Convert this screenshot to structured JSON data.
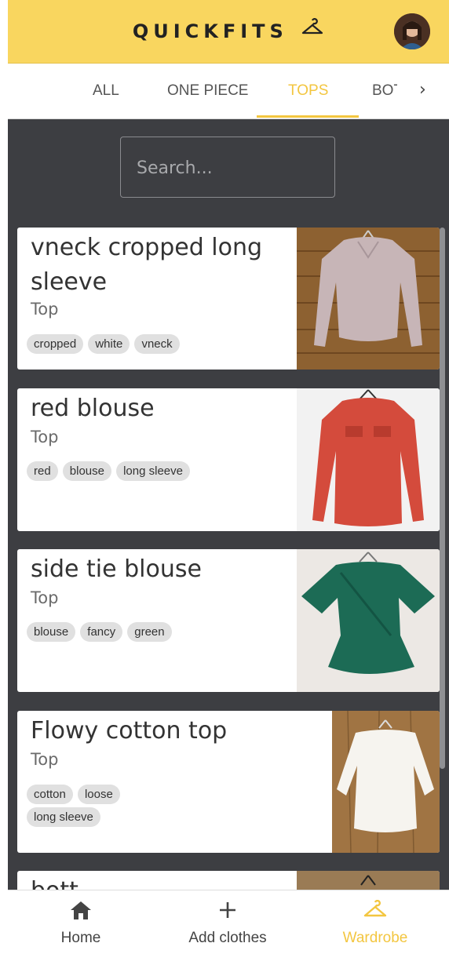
{
  "header": {
    "brand": "QUICKFITS"
  },
  "tabs": {
    "items": [
      {
        "label": "ALL"
      },
      {
        "label": "ONE PIECE"
      },
      {
        "label": "TOPS"
      },
      {
        "label": "BOT"
      }
    ],
    "active": "TOPS"
  },
  "search": {
    "placeholder": "Search..."
  },
  "items": [
    {
      "title": "vneck cropped long sleeve",
      "category": "Top",
      "tags": [
        "cropped",
        "white",
        "vneck"
      ]
    },
    {
      "title": "red blouse",
      "category": "Top",
      "tags": [
        "red",
        "blouse",
        "long sleeve"
      ]
    },
    {
      "title": "side tie blouse",
      "category": "Top",
      "tags": [
        "blouse",
        "fancy",
        "green"
      ]
    },
    {
      "title": "Flowy cotton top",
      "category": "Top",
      "tags": [
        "cotton",
        "loose",
        "long sleeve"
      ]
    },
    {
      "title": "bott",
      "category": "",
      "tags": []
    }
  ],
  "nav": [
    {
      "label": "Home",
      "icon": "home-icon"
    },
    {
      "label": "Add clothes",
      "icon": "plus-icon"
    },
    {
      "label": "Wardrobe",
      "icon": "hanger-icon"
    }
  ],
  "colors": {
    "accent": "#f3c640",
    "header": "#f9d65f",
    "background": "#3d3e42"
  }
}
